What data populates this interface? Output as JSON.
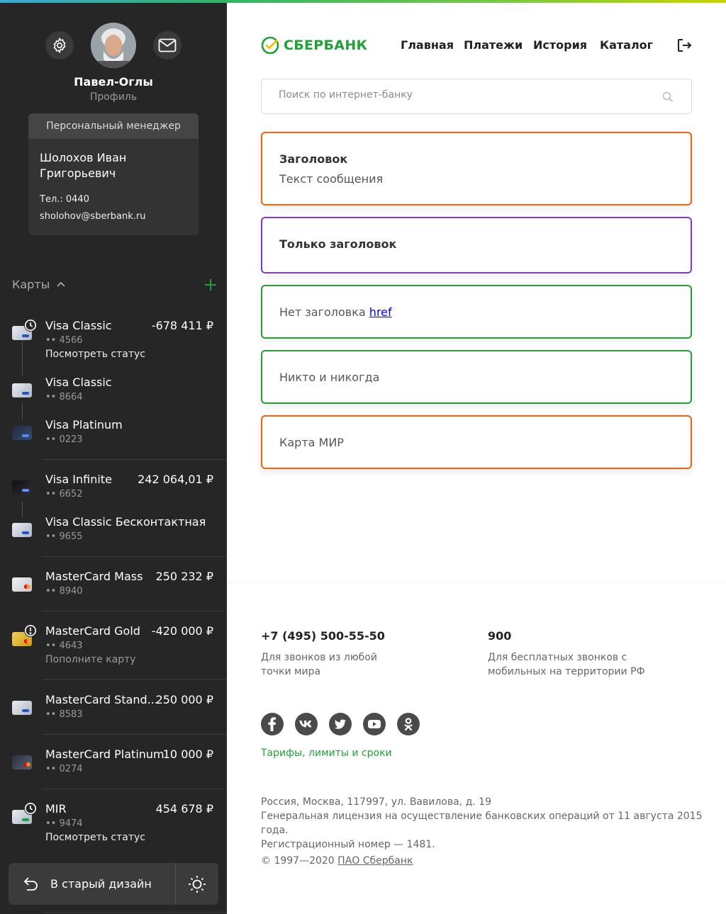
{
  "sidebar": {
    "user_name": "Павел-Оглы",
    "user_subtitle": "Профиль",
    "manager": {
      "header": "Персональный менеджер",
      "name": "Шолохов Иван Григорьевич",
      "phone": "Тел.: 0440",
      "email": "sholohov@sberbank.ru"
    },
    "cards_title": "Карты",
    "cards": [
      {
        "name": "Visa Classic",
        "number": "•• 4566",
        "amount": "-678 411 ₽",
        "status": "Посмотреть статус",
        "icon": "card-silver-visa",
        "badge": "clock-icon"
      },
      {
        "name": "Visa Classic",
        "number": "•• 8664",
        "amount": "",
        "status": "",
        "icon": "card-silver-visa",
        "badge": ""
      },
      {
        "name": "Visa Platinum",
        "number": "•• 0223",
        "amount": "",
        "status": "",
        "icon": "card-dark-visa",
        "badge": ""
      },
      {
        "name": "Visa Infinite",
        "number": "•• 6652",
        "amount": "242 064,01 ₽",
        "status": "",
        "icon": "card-dark-visa",
        "badge": ""
      },
      {
        "name": "Visa Classic Бесконтактная",
        "number": "•• 9655",
        "amount": "",
        "status": "",
        "icon": "card-silver-visa",
        "badge": ""
      },
      {
        "name": "MasterCard Mass",
        "number": "•• 8940",
        "amount": "250 232 ₽",
        "status": "",
        "icon": "card-silver-mc",
        "badge": ""
      },
      {
        "name": "MasterCard Gold",
        "number": "•• 4643",
        "amount": "-420 000 ₽",
        "status": "Пополните карту",
        "icon": "card-gold-mc",
        "badge": "alert-icon"
      },
      {
        "name": "MasterCard Stand...",
        "number": "•• 8583",
        "amount": "250 000 ₽",
        "status": "",
        "icon": "card-silver-visa",
        "badge": ""
      },
      {
        "name": "MasterCard Platinum",
        "number": "•• 0274",
        "amount": "10 000 ₽",
        "status": "",
        "icon": "card-dark-mc",
        "badge": ""
      },
      {
        "name": "MIR",
        "number": "•• 9474",
        "amount": "454 678 ₽",
        "status": "Посмотреть статус",
        "icon": "card-silver-mir",
        "badge": "clock-icon"
      }
    ],
    "old_design_label": "В старый дизайн"
  },
  "header": {
    "logo_text": "СБЕРБАНК",
    "nav": [
      "Главная",
      "Платежи",
      "История",
      "Каталог"
    ]
  },
  "search": {
    "placeholder": "Поиск по интернет-банку"
  },
  "messages": [
    {
      "title": "Заголовок",
      "text": "Текст сообщения",
      "border": "#f0640f"
    },
    {
      "title": "Только заголовок",
      "text": "",
      "border": "#7d3bbd"
    },
    {
      "title": "",
      "text": "Нет заголовка",
      "link": "href",
      "border": "#21a038"
    },
    {
      "title": "",
      "text": "Никто и никогда",
      "border": "#21a038"
    },
    {
      "title": "",
      "text": "Карта МИР",
      "border": "#f0640f"
    }
  ],
  "footer": {
    "phone1": "+7 (495) 500-55-50",
    "phone1_desc": "Для звонков из любой точки мира",
    "phone2": "900",
    "phone2_desc": "Для бесплатных звонков с мобильных на территории РФ",
    "socials": [
      "facebook-icon",
      "vk-icon",
      "twitter-icon",
      "youtube-icon",
      "odnoklassniki-icon"
    ],
    "tariffs_link": "Тарифы, лимиты и сроки",
    "address_line1": "Россия, Москва, 117997, ул. Вавилова, д. 19",
    "address_line2": "Генеральная лицензия на осуществление банковских операций от 11 августа 2015 года.",
    "address_line3": "Регистрационный номер — 1481.",
    "copyright": "© 1997—2020",
    "copyright_link": "ПАО Сбербанк"
  },
  "colors": {
    "brand_green": "#21a038",
    "sidebar_bg": "#262626",
    "orange": "#f0640f",
    "purple": "#7d3bbd"
  }
}
